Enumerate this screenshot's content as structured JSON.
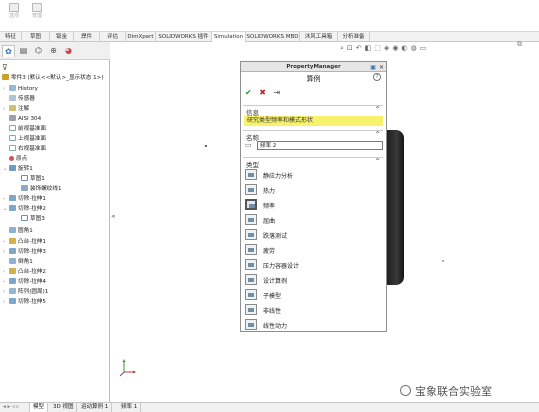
{
  "ribbon": {
    "buttons": [
      {
        "label": "选项",
        "icon": "options-icon"
      },
      {
        "label": "管理",
        "icon": "manage-icon"
      }
    ]
  },
  "command_tabs": [
    "特征",
    "草图",
    "钣金",
    "焊件",
    "评估",
    "DimXpert",
    "SOLIDWORKS 插件",
    "Simulation",
    "SOLIDWORKS MBD",
    "沐风工具箱",
    "分析准备"
  ],
  "active_command_tab": "Simulation",
  "tree": {
    "root": "零件3 (默认<<默认>_显示状态 1>)",
    "items": [
      {
        "label": "History",
        "icon": "history-icon"
      },
      {
        "label": "传感器",
        "icon": "sensor-icon"
      },
      {
        "label": "注解",
        "icon": "annotation-icon"
      },
      {
        "label": "AISI 304",
        "icon": "material-icon"
      },
      {
        "label": "前视基准面",
        "icon": "plane-icon"
      },
      {
        "label": "上视基准面",
        "icon": "plane-icon"
      },
      {
        "label": "右视基准面",
        "icon": "plane-icon"
      },
      {
        "label": "原点",
        "icon": "origin-icon"
      },
      {
        "label": "旋转1",
        "icon": "revolve-icon"
      },
      {
        "label": "草图1",
        "icon": "sketch-icon"
      },
      {
        "label": "装饰螺纹线1",
        "icon": "thread-icon"
      },
      {
        "label": "切除-拉伸1",
        "icon": "cut-extrude-icon"
      },
      {
        "label": "切除-拉伸2",
        "icon": "cut-extrude-icon"
      },
      {
        "label": "草图3",
        "icon": "sketch-icon"
      },
      {
        "label": "圆角1",
        "icon": "fillet-icon"
      },
      {
        "label": "凸台-拉伸1",
        "icon": "boss-extrude-icon"
      },
      {
        "label": "切除-拉伸3",
        "icon": "cut-extrude-icon"
      },
      {
        "label": "倒角1",
        "icon": "chamfer-icon"
      },
      {
        "label": "凸台-拉伸2",
        "icon": "boss-extrude-icon"
      },
      {
        "label": "切除-拉伸4",
        "icon": "cut-extrude-icon"
      },
      {
        "label": "阵列(圆周)1",
        "icon": "pattern-icon"
      },
      {
        "label": "切除-拉伸5",
        "icon": "cut-extrude-icon"
      }
    ]
  },
  "property_manager": {
    "header": "PropertyManager",
    "title": "算例",
    "help": "?",
    "actions": {
      "ok": "✔",
      "cancel": "✖",
      "pin": "⇥"
    },
    "info": {
      "label": "信息",
      "text": "研究类型频率和模式形状"
    },
    "name": {
      "label": "名称",
      "value": "频率 2"
    },
    "type": {
      "label": "类型",
      "options": [
        "静应力分析",
        "热力",
        "频率",
        "屈曲",
        "跌落测试",
        "疲劳",
        "压力容器设计",
        "设计算例",
        "子模型",
        "非线性",
        "线性动力"
      ],
      "selected": "频率"
    }
  },
  "bottom_tabs": [
    "模型",
    "3D 视图",
    "运动算例 1",
    "频率 1"
  ],
  "active_bottom_tab": "模型",
  "watermark": "宝象联合实验室",
  "colors": {
    "info_highlight": "#f7f26a",
    "model_dark": "#1c1c1c"
  }
}
